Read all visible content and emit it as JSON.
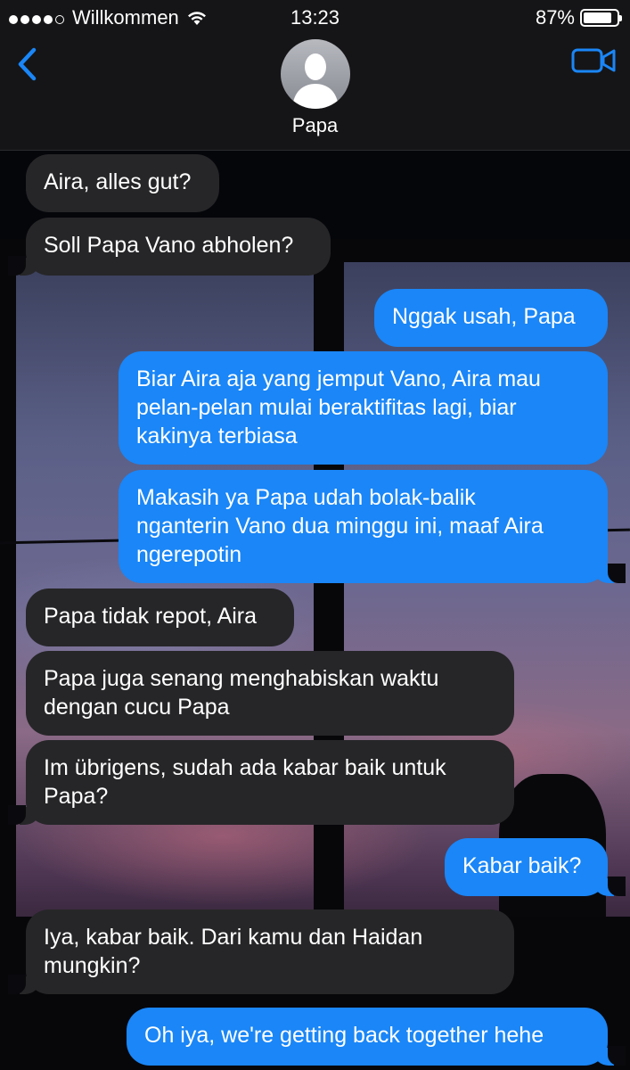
{
  "status_bar": {
    "carrier": "Willkommen",
    "time": "13:23",
    "battery": "87%",
    "battery_level": 0.87,
    "signal_bars": 4
  },
  "header": {
    "contact_name": "Papa",
    "back_icon": "chevron-left-icon",
    "video_icon": "video-camera-icon",
    "accent": "#1a86f7"
  },
  "messages": [
    {
      "side": "in",
      "text": "Aira, alles gut?"
    },
    {
      "side": "in",
      "text": "Soll Papa Vano abholen?"
    },
    {
      "side": "out",
      "text": "Nggak usah, Papa"
    },
    {
      "side": "out",
      "text": "Biar Aira aja yang jemput Vano, Aira mau\npelan-pelan mulai beraktifitas lagi, biar\nkakinya terbiasa"
    },
    {
      "side": "out",
      "text": "Makasih ya Papa udah bolak-balik\nnganterin Vano dua minggu ini, maaf Aira\nngerepotin"
    },
    {
      "side": "in",
      "text": "Papa tidak repot, Aira"
    },
    {
      "side": "in",
      "text": "Papa juga senang menghabiskan waktu\ndengan cucu Papa"
    },
    {
      "side": "in",
      "text": "Im übrigens, sudah ada kabar baik untuk\nPapa?"
    },
    {
      "side": "out",
      "text": "Kabar baik?"
    },
    {
      "side": "in",
      "text": "Iya, kabar baik. Dari kamu dan Haidan\nmungkin?"
    },
    {
      "side": "out",
      "text": "Oh iya, we're getting back together hehe"
    }
  ]
}
